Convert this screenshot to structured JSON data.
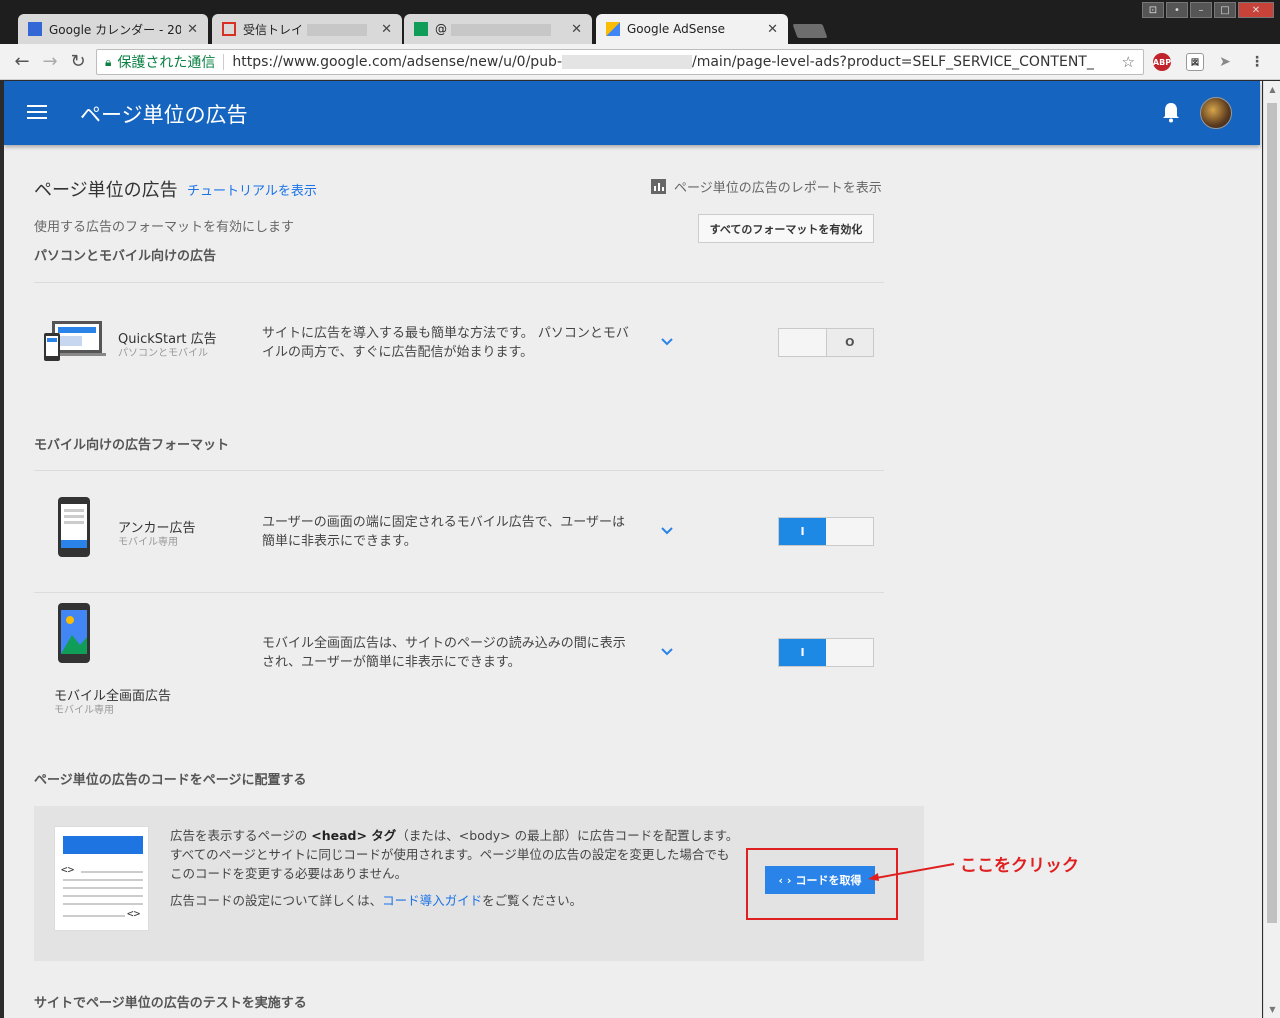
{
  "browser": {
    "tabs": [
      {
        "title": "Google カレンダー - 20",
        "icon": "calendar-icon",
        "color": "#3367d6"
      },
      {
        "title": "受信トレイ",
        "icon": "gmail-icon",
        "color": "#d93025"
      },
      {
        "title": "@",
        "icon": "sheets-icon",
        "color": "#0f9d58"
      },
      {
        "title": "Google AdSense",
        "icon": "adsense-icon",
        "color": "#fbbc04"
      }
    ],
    "secure_label": "保護された通信",
    "url_prefix": "https://www.google.com/adsense/new/u/0/pub-",
    "url_suffix": "/main/page-level-ads?product=SELF_SERVICE_CONTENT_"
  },
  "appbar": {
    "title": "ページ単位の広告",
    "bg": "#1565c0"
  },
  "header": {
    "title": "ページ単位の広告",
    "tutorial_link": "チュートリアルを表示",
    "report_link": "ページ単位の広告のレポートを表示",
    "subtitle": "使用する広告のフォーマットを有効にします",
    "enable_all": "すべてのフォーマットを有効化"
  },
  "sections": {
    "desktop_mobile": "パソコンとモバイル向けの広告",
    "mobile": "モバイル向けの広告フォーマット",
    "code": "ページ単位の広告のコードをページに配置する",
    "test": "サイトでページ単位の広告のテストを実施する"
  },
  "formats": [
    {
      "name": "QuickStart 広告",
      "sub": "パソコンとモバイル",
      "desc": "サイトに広告を導入する最も簡単な方法です。 パソコンとモバイルの両方で、すぐに広告配信が始まります。",
      "state": "O",
      "on": false
    },
    {
      "name": "アンカー広告",
      "sub": "モバイル専用",
      "desc": "ユーザーの画面の端に固定されるモバイル広告で、ユーザーは簡単に非表示にできます。",
      "state": "I",
      "on": true
    },
    {
      "name": "モバイル全画面広告",
      "sub": "モバイル専用",
      "desc": "モバイル全画面広告は、サイトのページの読み込みの間に表示され、ユーザーが簡単に非表示にできます。",
      "state": "I",
      "on": true
    }
  ],
  "code": {
    "line1_a": "広告を表示するページの ",
    "line1_b": "<head> タグ",
    "line1_c": "（または、<body> の最上部）に広告コードを配置します。",
    "line2": "すべてのページとサイトに同じコードが使用されます。ページ単位の広告の設定を変更した場合でもこのコードを変更する必要はありません。",
    "line3_a": "広告コードの設定について詳しくは、",
    "line3_link": "コード導入ガイド",
    "line3_b": "をご覧ください。",
    "button": "コードを取得",
    "doc_tag": "<>"
  },
  "annotation": {
    "callout": "ここをクリック",
    "color": "#e02020"
  }
}
